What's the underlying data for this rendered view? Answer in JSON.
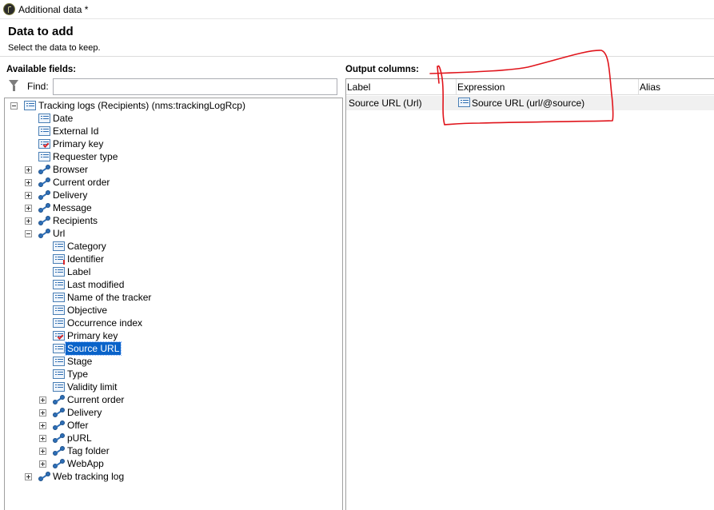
{
  "window": {
    "title": "Additional data *"
  },
  "header": {
    "title": "Data to add",
    "subtitle": "Select the data to keep."
  },
  "left": {
    "label": "Available fields:",
    "find_label": "Find:",
    "find_value": "",
    "tree": [
      {
        "label": "Tracking logs (Recipients) (nms:trackingLogRcp)",
        "icon": "list-icon",
        "expander": "minus"
      },
      {
        "label": "Date",
        "icon": "list-icon"
      },
      {
        "label": "External Id",
        "icon": "list-icon"
      },
      {
        "label": "Primary key",
        "icon": "key-list-icon"
      },
      {
        "label": "Requester type",
        "icon": "list-icon"
      },
      {
        "label": "Browser",
        "icon": "link-icon",
        "expander": "plus"
      },
      {
        "label": "Current order",
        "icon": "link-icon",
        "expander": "plus"
      },
      {
        "label": "Delivery",
        "icon": "link-icon",
        "expander": "plus"
      },
      {
        "label": "Message",
        "icon": "link-icon",
        "expander": "plus"
      },
      {
        "label": "Recipients",
        "icon": "link-icon",
        "expander": "plus"
      },
      {
        "label": "Url",
        "icon": "link-icon",
        "expander": "minus"
      },
      {
        "label": "Category",
        "icon": "list-icon"
      },
      {
        "label": "Identifier",
        "icon": "warn-list-icon"
      },
      {
        "label": "Label",
        "icon": "list-icon"
      },
      {
        "label": "Last modified",
        "icon": "list-icon"
      },
      {
        "label": "Name of the tracker",
        "icon": "list-icon"
      },
      {
        "label": "Objective",
        "icon": "list-icon"
      },
      {
        "label": "Occurrence index",
        "icon": "list-icon"
      },
      {
        "label": "Primary key",
        "icon": "key-list-icon"
      },
      {
        "label": "Source URL",
        "icon": "list-icon",
        "selected": true
      },
      {
        "label": "Stage",
        "icon": "list-icon"
      },
      {
        "label": "Type",
        "icon": "list-icon"
      },
      {
        "label": "Validity limit",
        "icon": "list-icon"
      },
      {
        "label": "Current order",
        "icon": "link-icon",
        "expander": "plus"
      },
      {
        "label": "Delivery",
        "icon": "link-icon",
        "expander": "plus"
      },
      {
        "label": "Offer",
        "icon": "link-icon",
        "expander": "plus"
      },
      {
        "label": "pURL",
        "icon": "link-icon",
        "expander": "plus"
      },
      {
        "label": "Tag folder",
        "icon": "link-icon",
        "expander": "plus"
      },
      {
        "label": "WebApp",
        "icon": "link-icon",
        "expander": "plus"
      },
      {
        "label": "Web tracking log",
        "icon": "link-icon",
        "expander": "plus"
      }
    ]
  },
  "right": {
    "label": "Output columns:",
    "columns": [
      "Label",
      "Expression",
      "Alias"
    ],
    "rows": [
      {
        "label": "Source URL (Url)",
        "expression": "Source URL (url/@source)",
        "alias": ""
      }
    ]
  },
  "colors": {
    "selection": "#0a63c9",
    "annotation": "#e0141b",
    "icon_blue": "#2e6fb7"
  }
}
